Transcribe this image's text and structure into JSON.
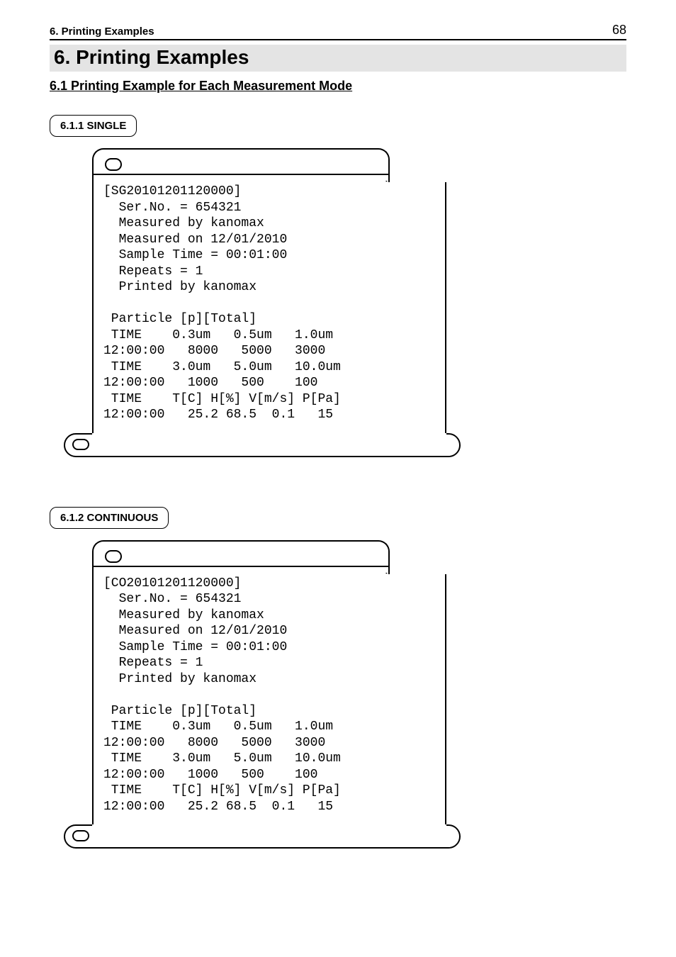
{
  "header": {
    "left": "6. Printing Examples",
    "page": "68"
  },
  "title": "6. Printing Examples",
  "section": "6.1 Printing Example for Each Measurement Mode",
  "sub1": {
    "label": "6.1.1 SINGLE",
    "printout": "[SG20101201120000]\n  Ser.No. = 654321\n  Measured by kanomax\n  Measured on 12/01/2010\n  Sample Time = 00:01:00\n  Repeats = 1\n  Printed by kanomax\n\n Particle [p][Total]\n TIME    0.3um   0.5um   1.0um\n12:00:00   8000   5000   3000\n TIME    3.0um   5.0um   10.0um\n12:00:00   1000   500    100\n TIME    T[C] H[%] V[m/s] P[Pa]\n12:00:00   25.2 68.5  0.1   15"
  },
  "sub2": {
    "label": "6.1.2 CONTINUOUS",
    "printout": "[CO20101201120000]\n  Ser.No. = 654321\n  Measured by kanomax\n  Measured on 12/01/2010\n  Sample Time = 00:01:00\n  Repeats = 1\n  Printed by kanomax\n\n Particle [p][Total]\n TIME    0.3um   0.5um   1.0um\n12:00:00   8000   5000   3000\n TIME    3.0um   5.0um   10.0um\n12:00:00   1000   500    100\n TIME    T[C] H[%] V[m/s] P[Pa]\n12:00:00   25.2 68.5  0.1   15\n"
  }
}
